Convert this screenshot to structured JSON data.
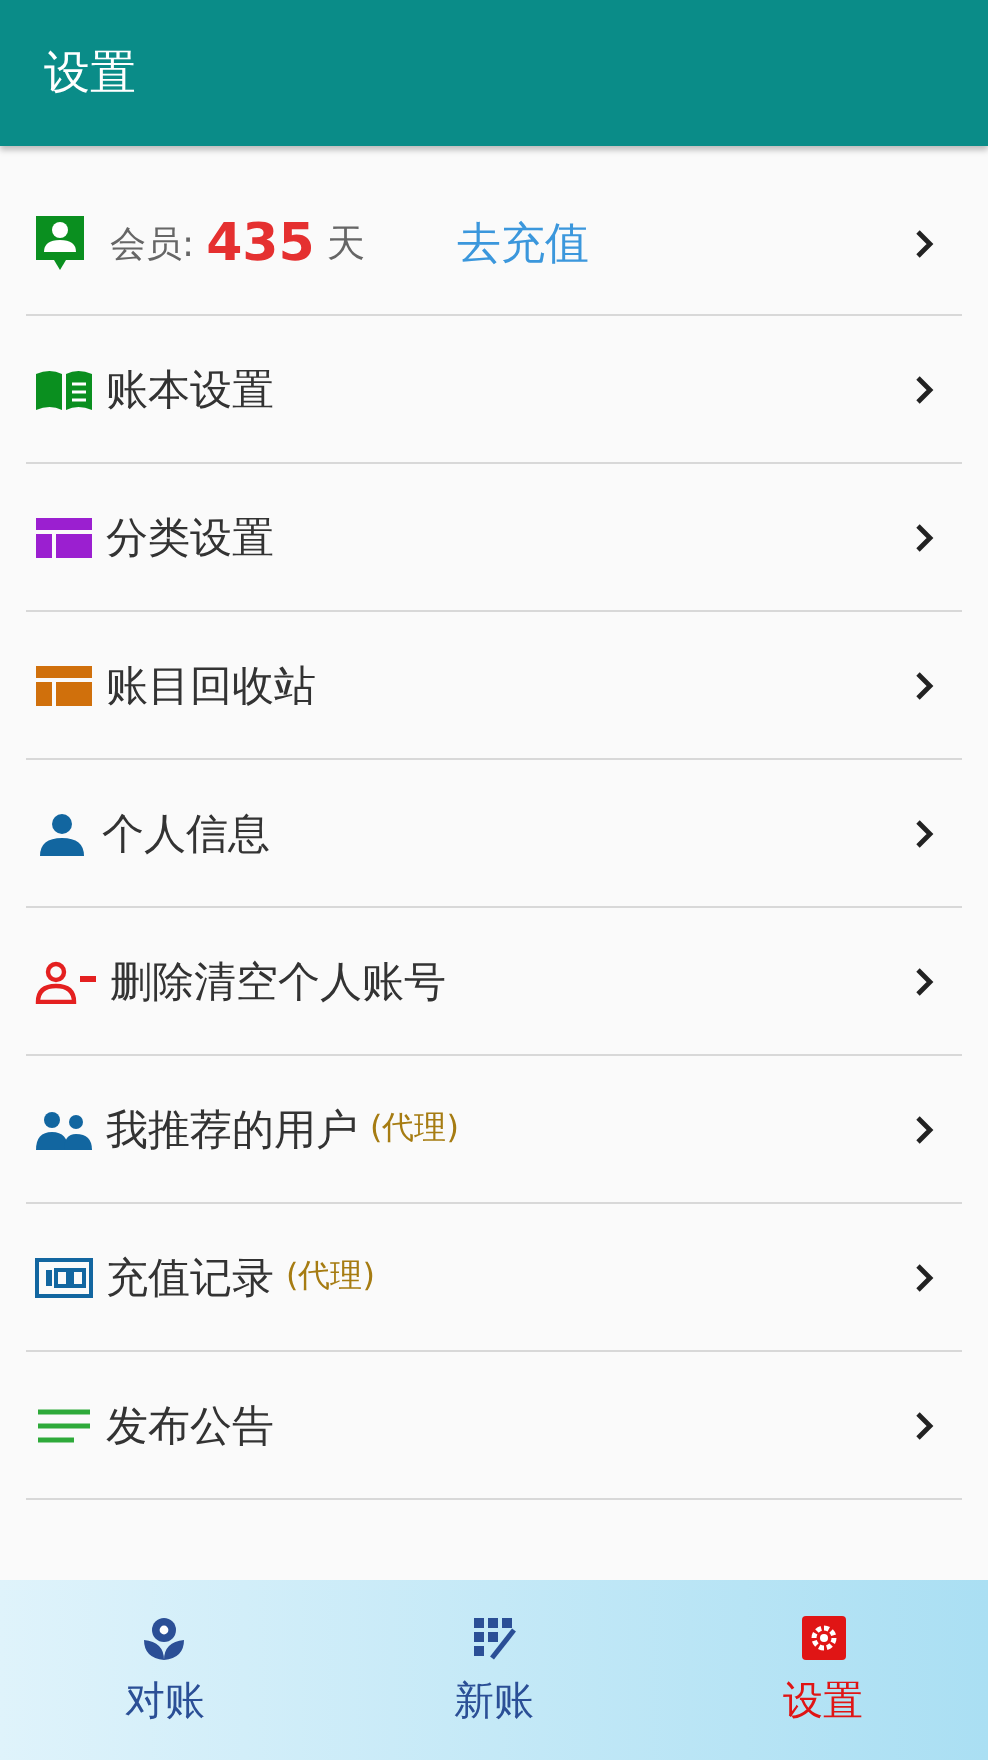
{
  "header": {
    "title": "设置"
  },
  "member": {
    "label": "会员:",
    "days": "435",
    "unit": "天",
    "action": "去充值"
  },
  "items": [
    {
      "label": "账本设置"
    },
    {
      "label": "分类设置"
    },
    {
      "label": "账目回收站"
    },
    {
      "label": "个人信息"
    },
    {
      "label": "删除清空个人账号"
    },
    {
      "label": "我推荐的用户",
      "tag": "(代理)"
    },
    {
      "label": "充值记录",
      "tag": "(代理)"
    },
    {
      "label": "发布公告"
    }
  ],
  "tabs": [
    {
      "label": "对账",
      "selected": false
    },
    {
      "label": "新账",
      "selected": false
    },
    {
      "label": "设置",
      "selected": true
    }
  ]
}
